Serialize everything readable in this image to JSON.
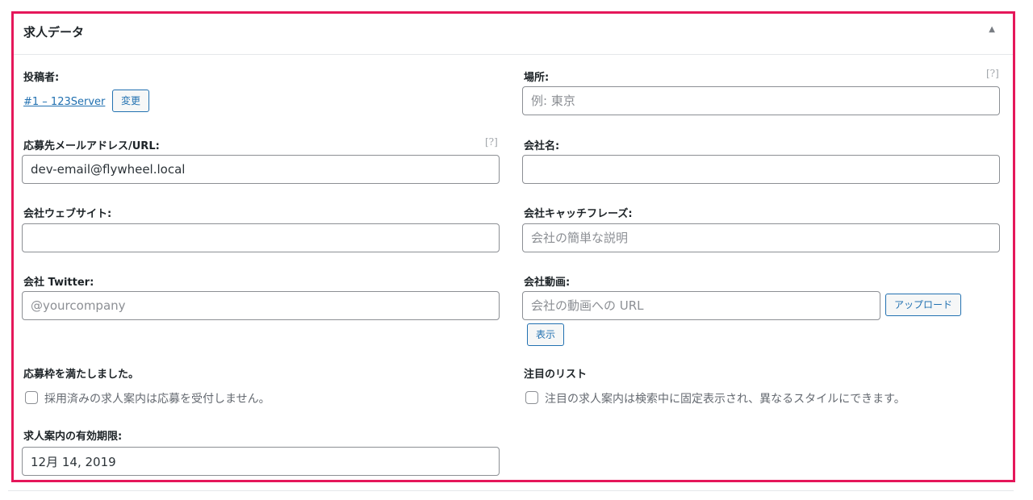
{
  "metabox": {
    "title": "求人データ",
    "toggle_icon": "▲"
  },
  "left": {
    "poster": {
      "label": "投稿者:",
      "user_link": "#1 – 123Server",
      "change_button": "変更"
    },
    "application": {
      "label": "応募先メールアドレス/URL:",
      "help": "[?]",
      "value": "dev-email@flywheel.local",
      "placeholder": ""
    },
    "company_website": {
      "label": "会社ウェブサイト:",
      "value": "",
      "placeholder": ""
    },
    "company_twitter": {
      "label": "会社 Twitter:",
      "value": "",
      "placeholder": "@yourcompany"
    },
    "filled": {
      "label": "応募枠を満たしました。",
      "checkbox_text": "採用済みの求人案内は応募を受付しません。",
      "checked": false
    },
    "expires": {
      "label": "求人案内の有効期限:",
      "value": "12月 14, 2019",
      "placeholder": ""
    }
  },
  "right": {
    "location": {
      "label": "場所:",
      "help": "[?]",
      "value": "",
      "placeholder": "例: 東京"
    },
    "company_name": {
      "label": "会社名:",
      "value": "",
      "placeholder": ""
    },
    "company_tagline": {
      "label": "会社キャッチフレーズ:",
      "value": "",
      "placeholder": "会社の簡単な説明"
    },
    "company_video": {
      "label": "会社動画:",
      "value": "",
      "placeholder": "会社の動画への URL",
      "upload_button": "アップロード",
      "view_button": "表示"
    },
    "featured": {
      "label": "注目のリスト",
      "checkbox_text": "注目の求人案内は検索中に固定表示され、異なるスタイルにできます。",
      "checked": false
    }
  },
  "colors": {
    "highlight_border": "#e5175a",
    "link": "#2271b1",
    "input_border": "#8c8f94"
  }
}
